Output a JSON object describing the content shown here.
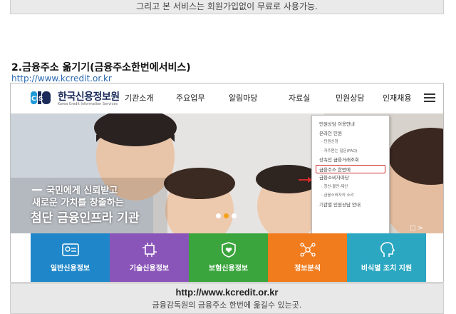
{
  "top_banner": {
    "text": "그리고 본 서비스는 회원가입없이 무료로 사용가능."
  },
  "section": {
    "heading": "2.금융주소 옮기기(금융주소한번에서비스)",
    "link": "http://www.kcredit.or.kr"
  },
  "site": {
    "logo_abbr": "CIS",
    "logo_kor": "한국신용정보원",
    "logo_eng": "Korea Credit Information Services",
    "nav": [
      "기관소개",
      "주요업무",
      "알림마당",
      "자료실",
      "민원상담",
      "인재채용"
    ]
  },
  "hero": {
    "line1": "국민에게 신뢰받고",
    "line2": "새로운 가치를 창출하는",
    "title": "첨단 금융인프라 기관",
    "slide_control": "□ >"
  },
  "dropdown": {
    "items": [
      {
        "label": "민원상담 이용안내",
        "sub": false,
        "highlight": false
      },
      {
        "label": "온라인 민원",
        "sub": false,
        "highlight": false
      },
      {
        "label": "· 민원신청",
        "sub": true,
        "highlight": false
      },
      {
        "label": "· 자주묻는 질문(FAQ)",
        "sub": true,
        "highlight": false
      },
      {
        "label": "상속인 금융거래조회",
        "sub": false,
        "highlight": false
      },
      {
        "label": "금융주소 한번에",
        "sub": false,
        "highlight": true
      },
      {
        "label": "금융소비자마당",
        "sub": false,
        "highlight": false
      },
      {
        "label": "· 칭찬·불만·제안",
        "sub": true,
        "highlight": false
      },
      {
        "label": "· 금융소비자의 소리",
        "sub": true,
        "highlight": false
      },
      {
        "label": "기관별 민원상담 안내",
        "sub": false,
        "highlight": false
      }
    ]
  },
  "tiles": [
    {
      "label": "일반신용정보",
      "color": "#1f87c9"
    },
    {
      "label": "기술신용정보",
      "color": "#8a55b8"
    },
    {
      "label": "보험신용정보",
      "color": "#3aa53c"
    },
    {
      "label": "정보분석",
      "color": "#f07c1e"
    },
    {
      "label": "비식별 조치 지원",
      "color": "#2ba7c2"
    }
  ],
  "bottom_banner": {
    "url": "http://www.kcredit.or.kr",
    "caption": "금융감독원의 금융주소 한번에 옮길수 있는곳."
  },
  "colors": {
    "highlight": "#d42b2b",
    "link": "#2a6ab0",
    "active_dot": "#f2a21a"
  }
}
